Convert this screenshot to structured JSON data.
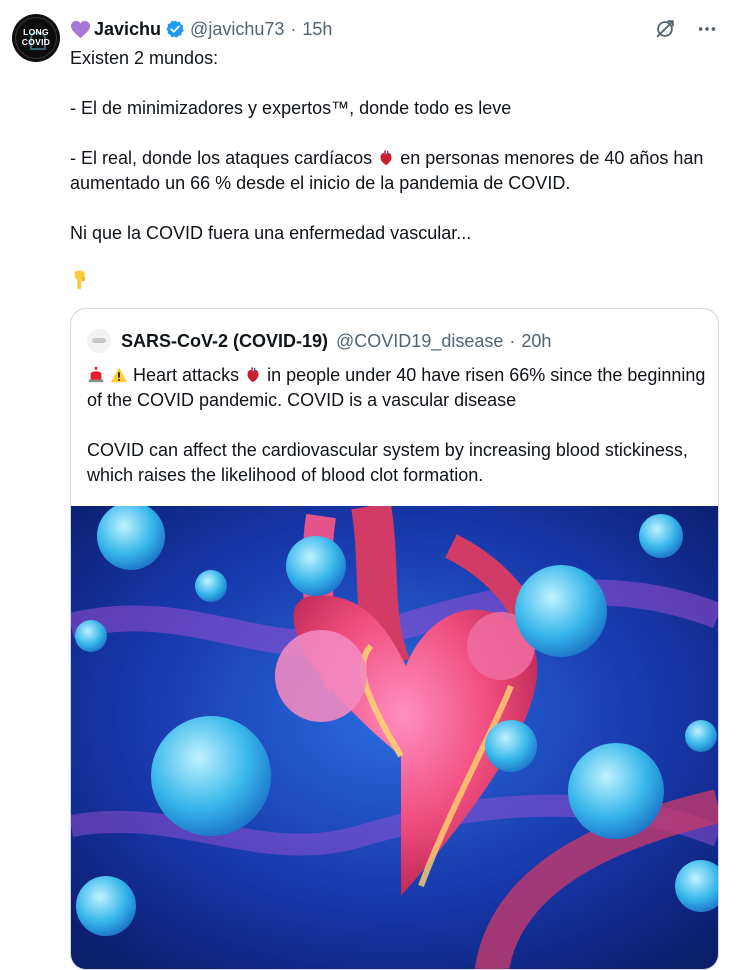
{
  "author": {
    "avatar_lines": [
      "LONG",
      "COVID"
    ],
    "name": "Javichu",
    "handle": "@javichu73",
    "separator": "·",
    "time": "15h",
    "name_emoji": "purple-heart-icon",
    "verified": "verified-badge-icon"
  },
  "tweet": {
    "line1": "Existen 2 mundos:",
    "line2": "- El de minimizadores y expertos™, donde todo es leve",
    "line3_before": "- El real, donde los ataques cardíacos",
    "line3_after": "en personas menores de 40 años han aumentado un 66 % desde el inicio de la pandemia de COVID.",
    "line4": "Ni que la COVID fuera una enfermedad vascular...",
    "trailing_emoji": "pointing-down-hand-icon"
  },
  "quoted": {
    "name": "SARS-CoV-2 (COVID-19)",
    "handle": "@COVID19_disease",
    "separator": "·",
    "time": "20h",
    "text1_before": "Heart attacks",
    "text1_after": "in people under 40 have risen 66% since the beginning of the COVID pandemic. COVID is a vascular disease",
    "text2": "COVID can affect the cardiovascular system by increasing blood stickiness, which raises the likelihood of blood clot formation.",
    "leading_emojis": [
      "rotating-light-icon",
      "warning-icon"
    ],
    "image": "heart-with-virus-illustration"
  },
  "icons": {
    "grok": "grok-icon",
    "more": "more-icon"
  },
  "colors": {
    "text": "#0f1419",
    "secondary": "#536471",
    "verified": "#1d9bf0",
    "border": "#cfd9de"
  }
}
